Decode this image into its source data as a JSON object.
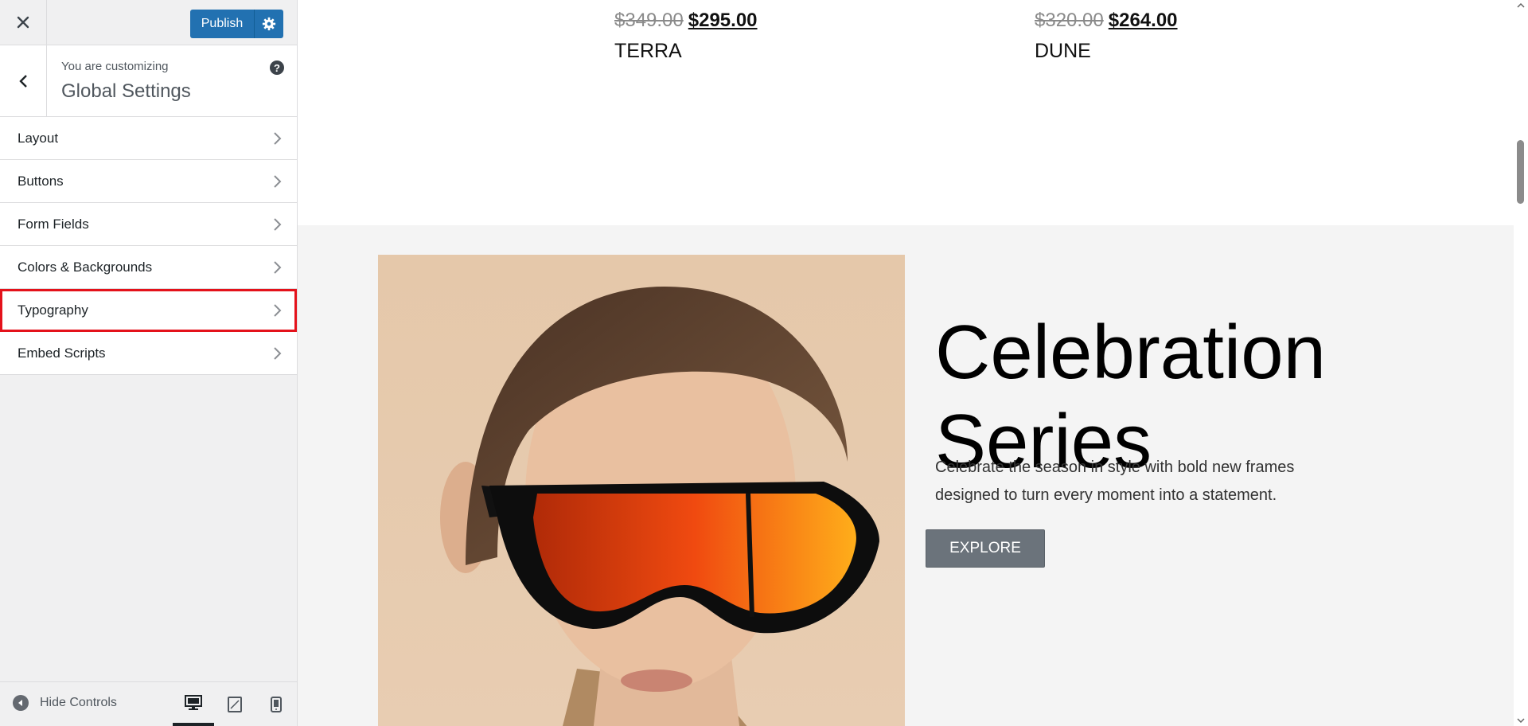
{
  "sidebar": {
    "publish_label": "Publish",
    "customizing_label": "You are customizing",
    "section_title": "Global Settings",
    "help_icon_glyph": "?",
    "menu_items": [
      {
        "label": "Layout"
      },
      {
        "label": "Buttons"
      },
      {
        "label": "Form Fields"
      },
      {
        "label": "Colors & Backgrounds"
      },
      {
        "label": "Typography",
        "highlighted": true
      },
      {
        "label": "Embed Scripts"
      }
    ],
    "footer": {
      "hide_controls_label": "Hide Controls",
      "devices": [
        "desktop-icon",
        "tablet-icon",
        "mobile-icon"
      ],
      "active_device": "desktop"
    }
  },
  "preview": {
    "products": [
      {
        "old_price": "$349.00",
        "new_price": "$295.00",
        "name": "TERRA"
      },
      {
        "old_price": "$320.00",
        "new_price": "$264.00",
        "name": "DUNE"
      }
    ],
    "hero": {
      "title_line1": "Celebration",
      "title_line2": "Series",
      "description": "Celebrate the season in style with bold new frames designed to turn every moment into a statement.",
      "button_label": "EXPLORE"
    }
  },
  "colors": {
    "publish_blue": "#2271b1",
    "highlight_red": "#e4121b",
    "explore_button": "#6b737b",
    "hero_background": "#f4f4f4"
  }
}
